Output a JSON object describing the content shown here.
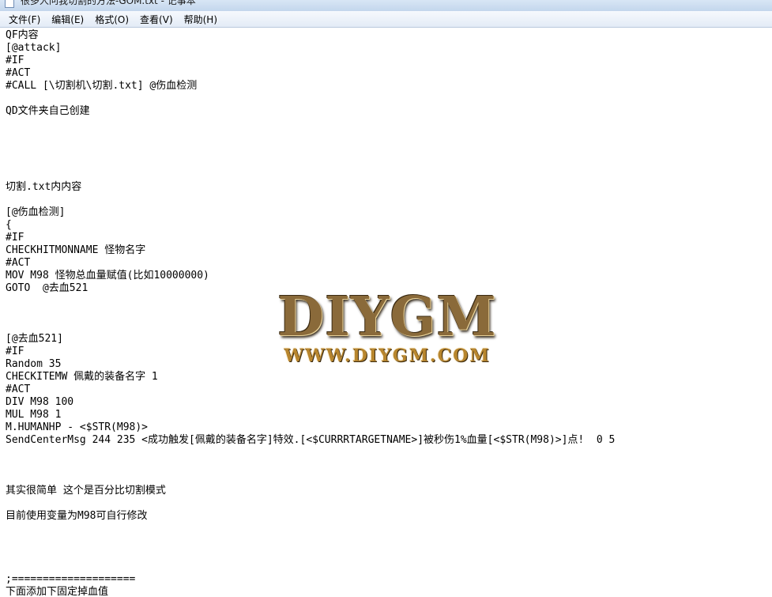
{
  "window": {
    "title": "很多人问我切割的方法-GOM.txt - 记事本"
  },
  "menu": {
    "items": [
      "文件(F)",
      "编辑(E)",
      "格式(O)",
      "查看(V)",
      "帮助(H)"
    ]
  },
  "document": {
    "lines": [
      "QF内容",
      "[@attack]",
      "#IF",
      "#ACT",
      "#CALL [\\切割机\\切割.txt] @伤血检测",
      "",
      "QD文件夹自己创建",
      "",
      "",
      "",
      "",
      "",
      "切割.txt内内容",
      "",
      "[@伤血检测]",
      "{",
      "#IF",
      "CHECKHITMONNAME 怪物名字",
      "#ACT",
      "MOV M98 怪物总血量赋值(比如10000000)",
      "GOTO  @去血521",
      "",
      "",
      "",
      "[@去血521]",
      "#IF",
      "Random 35",
      "CHECKITEMW 佩戴的装备名字 1",
      "#ACT",
      "DIV M98 100",
      "MUL M98 1",
      "M.HUMANHP - <$STR(M98)>",
      "SendCenterMsg 244 235 <成功触发[佩戴的装备名字]特效.[<$CURRRTARGETNAME>]被秒伤1%血量[<$STR(M98)>]点!  0 5",
      "",
      "",
      "",
      "其实很简单 这个是百分比切割模式",
      "",
      "目前使用变量为M98可自行修改",
      "",
      "",
      "",
      "",
      ";====================",
      "下面添加下固定掉血值"
    ]
  },
  "watermark": {
    "logo": "DIYGM",
    "url": "WWW.DIYGM.COM"
  }
}
